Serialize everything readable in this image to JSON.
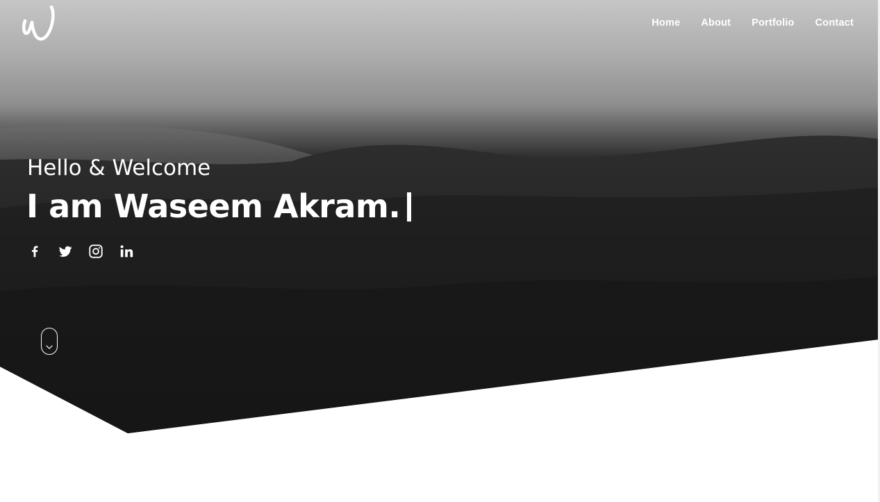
{
  "brand": {
    "logo_icon": "script-w-logo-icon"
  },
  "nav": {
    "items": [
      {
        "label": "Home"
      },
      {
        "label": "About"
      },
      {
        "label": "Portfolio"
      },
      {
        "label": "Contact"
      }
    ]
  },
  "hero": {
    "greeting": "Hello & Welcome",
    "headline": "I am Waseem Akram.",
    "typing_cursor": "|",
    "social": [
      {
        "icon": "facebook-icon"
      },
      {
        "icon": "twitter-icon"
      },
      {
        "icon": "instagram-icon"
      },
      {
        "icon": "linkedin-icon"
      }
    ],
    "scroll_icon": "mouse-scroll-down-icon"
  },
  "colors": {
    "text": "#ffffff",
    "page_background": "#ffffff",
    "hero_dark": "#1a1a1a",
    "sky": "#b8b8b8"
  }
}
